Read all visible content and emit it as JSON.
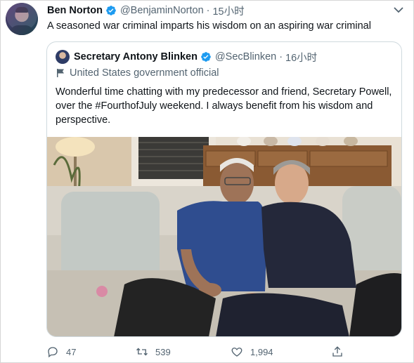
{
  "tweet": {
    "author": {
      "name": "Ben Norton",
      "handle": "@BenjaminNorton",
      "verified_icon": "verified-badge-icon"
    },
    "separator": "·",
    "time": "15小时",
    "text": "A seasoned war criminal imparts his wisdom on an aspiring war criminal",
    "more_icon": "chevron-down-icon"
  },
  "quoted_tweet": {
    "author": {
      "name": "Secretary Antony Blinken",
      "handle": "@SecBlinken",
      "verified_icon": "verified-badge-icon"
    },
    "separator": "·",
    "time": "16小时",
    "label": "United States government official",
    "text": "Wonderful time chatting with my predecessor and friend, Secretary Powell, over the #FourthofJuly weekend. I always benefit from his wisdom and perspective.",
    "photo_icon": "photo-two-men-on-sofa"
  },
  "actions": {
    "reply_count": "47",
    "retweet_count": "539",
    "like_count": "1,994"
  },
  "colors": {
    "verified_blue": "#1d9bf0",
    "secondary_text": "#536471",
    "border": "#cfd9de"
  }
}
